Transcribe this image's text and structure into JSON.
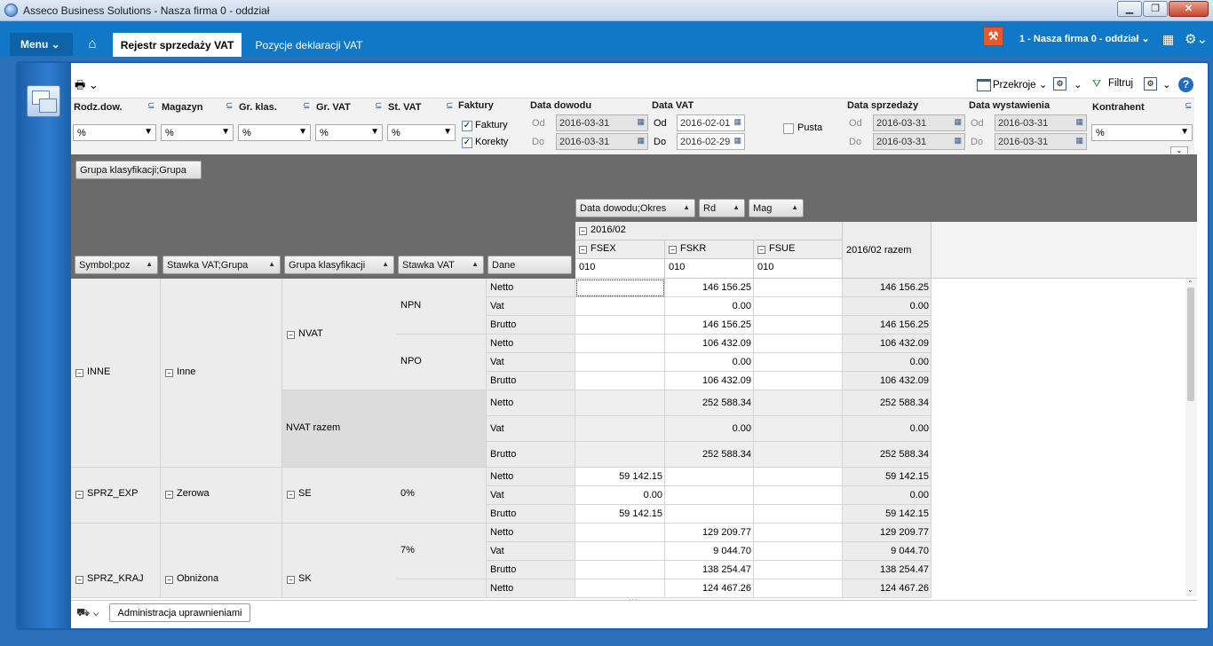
{
  "window": {
    "title": "Asseco Business Solutions - Nasza firma 0 - oddział",
    "min": "▁",
    "max": "❐",
    "close": "✕"
  },
  "nav": {
    "menu_label": "Menu ⌄",
    "home_icon": "⌂",
    "tabs": [
      {
        "label": "Rejestr sprzedaży VAT"
      },
      {
        "label": "Pozycje deklaracji VAT"
      }
    ],
    "company": "1 - Nasza firma 0 - oddział  ⌄",
    "tool_icon": "⚒",
    "grid_icon": "▦",
    "gear_icon": "⚙⌄"
  },
  "toolbar": {
    "print_icon": "🖶 ⌄",
    "przekroje": "Przekroje ⌄",
    "filtruj": "Filtruj",
    "help": "?"
  },
  "filters": {
    "rodz_dow": {
      "label": "Rodz.dow.",
      "value": "%"
    },
    "magazyn": {
      "label": "Magazyn",
      "value": "%"
    },
    "gr_klas": {
      "label": "Gr. klas.",
      "value": "%"
    },
    "gr_vat": {
      "label": "Gr. VAT",
      "value": "%"
    },
    "st_vat": {
      "label": "St. VAT",
      "value": "%"
    },
    "faktury": {
      "label": "Faktury",
      "opt1": "Faktury",
      "opt2": "Korekty"
    },
    "data_dowodu": {
      "label": "Data dowodu",
      "od_label": "Od",
      "do_label": "Do",
      "od": "2016-03-31",
      "do": "2016-03-31"
    },
    "data_vat": {
      "label": "Data VAT",
      "od_label": "Od",
      "do_label": "Do",
      "od": "2016-02-01",
      "do": "2016-02-29"
    },
    "pusta": "Pusta",
    "data_sprzedazy": {
      "label": "Data sprzedaży",
      "od_label": "Od",
      "do_label": "Do",
      "od": "2016-03-31",
      "do": "2016-03-31"
    },
    "data_wystawienia": {
      "label": "Data wystawienia",
      "od_label": "Od",
      "do_label": "Do",
      "od": "2016-03-31",
      "do": "2016-03-31"
    },
    "kontrahent": {
      "label": "Kontrahent",
      "value": "%"
    },
    "sort_icon": "⊆",
    "cal_icon": "▦"
  },
  "pivot": {
    "filter_field": "Grupa klasyfikacji;Grupa",
    "col_fields": [
      "Data dowodu;Okres",
      "Rd",
      "Mag"
    ],
    "row_fields": [
      "Symbol;poz",
      "Stawka VAT;Grupa",
      "Grupa klasyfikacji",
      "Stawka VAT"
    ],
    "data_field": "Dane",
    "period": "2016/02",
    "cols": [
      {
        "name": "FSEX",
        "sub": "010"
      },
      {
        "name": "FSKR",
        "sub": "010"
      },
      {
        "name": "FSUE",
        "sub": "010"
      }
    ],
    "total_col": "2016/02 razem",
    "row_groups": {
      "inne": "INNE",
      "inne_st": "Inne",
      "nvat": "NVAT",
      "npn": "NPN",
      "npo": "NPO",
      "nvat_razem": "NVAT razem",
      "sprz_exp": "SPRZ_EXP",
      "zerowa": "Zerowa",
      "se": "SE",
      "zero_pct": "0%",
      "sprz_kraj": "SPRZ_KRAJ",
      "obnizona": "Obniżona",
      "sk": "SK",
      "seven_pct": "7%"
    },
    "rows": [
      {
        "dane": "Netto",
        "fsex": "",
        "fskr": "146 156.25",
        "fsue": "",
        "total": "146 156.25"
      },
      {
        "dane": "Vat",
        "fsex": "",
        "fskr": "0.00",
        "fsue": "",
        "total": "0.00"
      },
      {
        "dane": "Brutto",
        "fsex": "",
        "fskr": "146 156.25",
        "fsue": "",
        "total": "146 156.25"
      },
      {
        "dane": "Netto",
        "fsex": "",
        "fskr": "106 432.09",
        "fsue": "",
        "total": "106 432.09"
      },
      {
        "dane": "Vat",
        "fsex": "",
        "fskr": "0.00",
        "fsue": "",
        "total": "0.00"
      },
      {
        "dane": "Brutto",
        "fsex": "",
        "fskr": "106 432.09",
        "fsue": "",
        "total": "106 432.09"
      },
      {
        "dane": "Netto",
        "fsex": "",
        "fskr": "252 588.34",
        "fsue": "",
        "total": "252 588.34"
      },
      {
        "dane": "Vat",
        "fsex": "",
        "fskr": "0.00",
        "fsue": "",
        "total": "0.00"
      },
      {
        "dane": "Brutto",
        "fsex": "",
        "fskr": "252 588.34",
        "fsue": "",
        "total": "252 588.34"
      },
      {
        "dane": "Netto",
        "fsex": "59 142.15",
        "fskr": "",
        "fsue": "",
        "total": "59 142.15"
      },
      {
        "dane": "Vat",
        "fsex": "0.00",
        "fskr": "",
        "fsue": "",
        "total": "0.00"
      },
      {
        "dane": "Brutto",
        "fsex": "59 142.15",
        "fskr": "",
        "fsue": "",
        "total": "59 142.15"
      },
      {
        "dane": "Netto",
        "fsex": "",
        "fskr": "129 209.77",
        "fsue": "",
        "total": "129 209.77"
      },
      {
        "dane": "Vat",
        "fsex": "",
        "fskr": "9 044.70",
        "fsue": "",
        "total": "9 044.70"
      },
      {
        "dane": "Brutto",
        "fsex": "",
        "fskr": "138 254.47",
        "fsue": "",
        "total": "138 254.47"
      },
      {
        "dane": "Netto",
        "fsex": "",
        "fskr": "124 467.26",
        "fsue": "",
        "total": "124 467.26"
      }
    ]
  },
  "bottom": {
    "admin_button": "Administracja uprawnieniami",
    "icon": "⛟ ⌄"
  }
}
